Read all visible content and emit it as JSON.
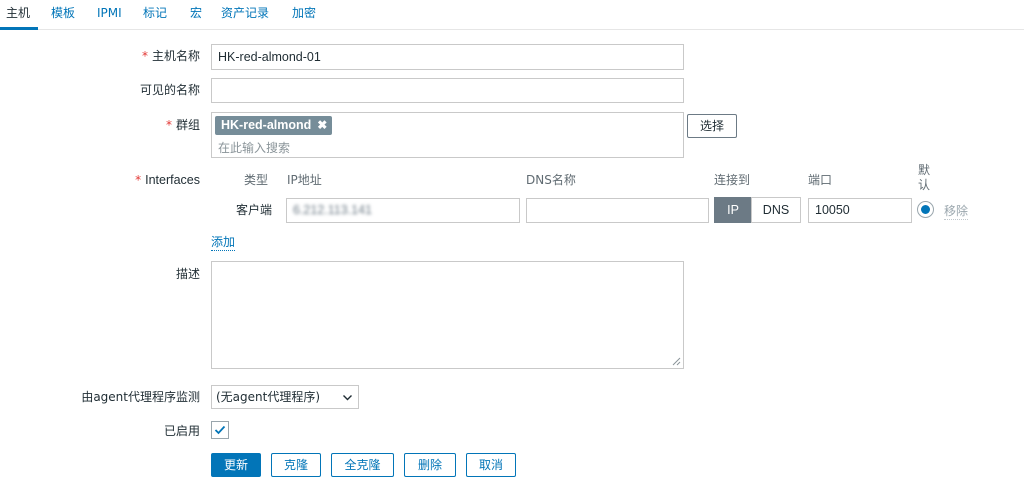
{
  "tabs": [
    {
      "label": "主机",
      "active": true
    },
    {
      "label": "模板"
    },
    {
      "label": "IPMI"
    },
    {
      "label": "标记"
    },
    {
      "label": "宏"
    },
    {
      "label": "资产记录"
    },
    {
      "label": "加密"
    }
  ],
  "form": {
    "host_name": {
      "required_mark": "*",
      "label": "主机名称",
      "value": "HK-red-almond-01"
    },
    "visible_name": {
      "label": "可见的名称",
      "value": ""
    },
    "groups": {
      "required_mark": "*",
      "label": "群组",
      "chip": "HK-red-almond",
      "chip_remove": "✖",
      "placeholder": "在此输入搜索",
      "select_button": "选择"
    },
    "interfaces": {
      "required_mark": "*",
      "label": "Interfaces",
      "headers": {
        "type": "类型",
        "ip": "IP地址",
        "dns": "DNS名称",
        "connect_to": "连接到",
        "port": "端口",
        "default": "默\n认"
      },
      "row": {
        "type": "客户端",
        "ip": "6.212.113.141",
        "dns": "",
        "connect_ip": "IP",
        "connect_dns": "DNS",
        "connect_selected": "IP",
        "port": "10050",
        "default_selected": true,
        "remove": "移除"
      },
      "add_link": "添加"
    },
    "description": {
      "label": "描述",
      "value": ""
    },
    "proxy": {
      "label": "由agent代理程序监测",
      "selected": "(无agent代理程序)"
    },
    "enabled": {
      "label": "已启用",
      "checked": true
    }
  },
  "buttons": {
    "update": "更新",
    "clone": "克隆",
    "full_clone": "全克隆",
    "delete": "删除",
    "cancel": "取消"
  },
  "colors": {
    "accent": "#0275b8",
    "required": "#e33734",
    "chip": "#768d99"
  }
}
